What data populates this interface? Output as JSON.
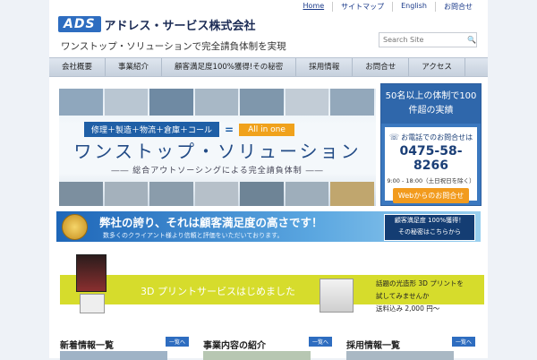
{
  "header": {
    "logo_mark": "ADS",
    "logo_text": "アドレス・サービス株式会社",
    "tagline": "ワンストップ・ソリューションで完全請負体制を実現",
    "top_links": [
      "Home",
      "サイトマップ",
      "English",
      "お問合せ"
    ],
    "search_placeholder": "Search Site"
  },
  "nav": {
    "items": [
      "会社概要",
      "事業紹介",
      "顧客満足度100%獲得!その秘密",
      "採用情報",
      "お問合せ",
      "アクセス"
    ]
  },
  "hero": {
    "formula": "修理＋製造＋物流＋倉庫＋コール",
    "equals": "=",
    "all_in_one": "All in one",
    "title": "ワンストップ・ソリューション",
    "subtitle": "―― 総合アウトソーシングによる完全請負体制 ――"
  },
  "side": {
    "head": "50名以上の体制で100件超の実績",
    "label": "お電話でのお問合せは",
    "phone": "0475-58-8266",
    "hours": "9:00 - 18:00（土日祝日を除く）",
    "button": "Webからのお問合せ"
  },
  "pride": {
    "title": "弊社の誇り、それは顧客満足度の高さです！",
    "subtitle": "数多くのクライアント様より信頼と評価をいただいております。",
    "box_line1": "顧客満足度 100%獲得！",
    "box_line2": "その秘密はこちらから"
  },
  "print": {
    "title": "3D プリントサービスはじめました",
    "line1": "話題の光造形 3D プリントを",
    "line2": "試してみませんか",
    "line3": "送料込み 2,000 円～"
  },
  "columns": {
    "c1_title": "新着情報一覧",
    "c2_title": "事業内容の紹介",
    "c3_title": "採用情報一覧",
    "more": "一覧へ"
  }
}
